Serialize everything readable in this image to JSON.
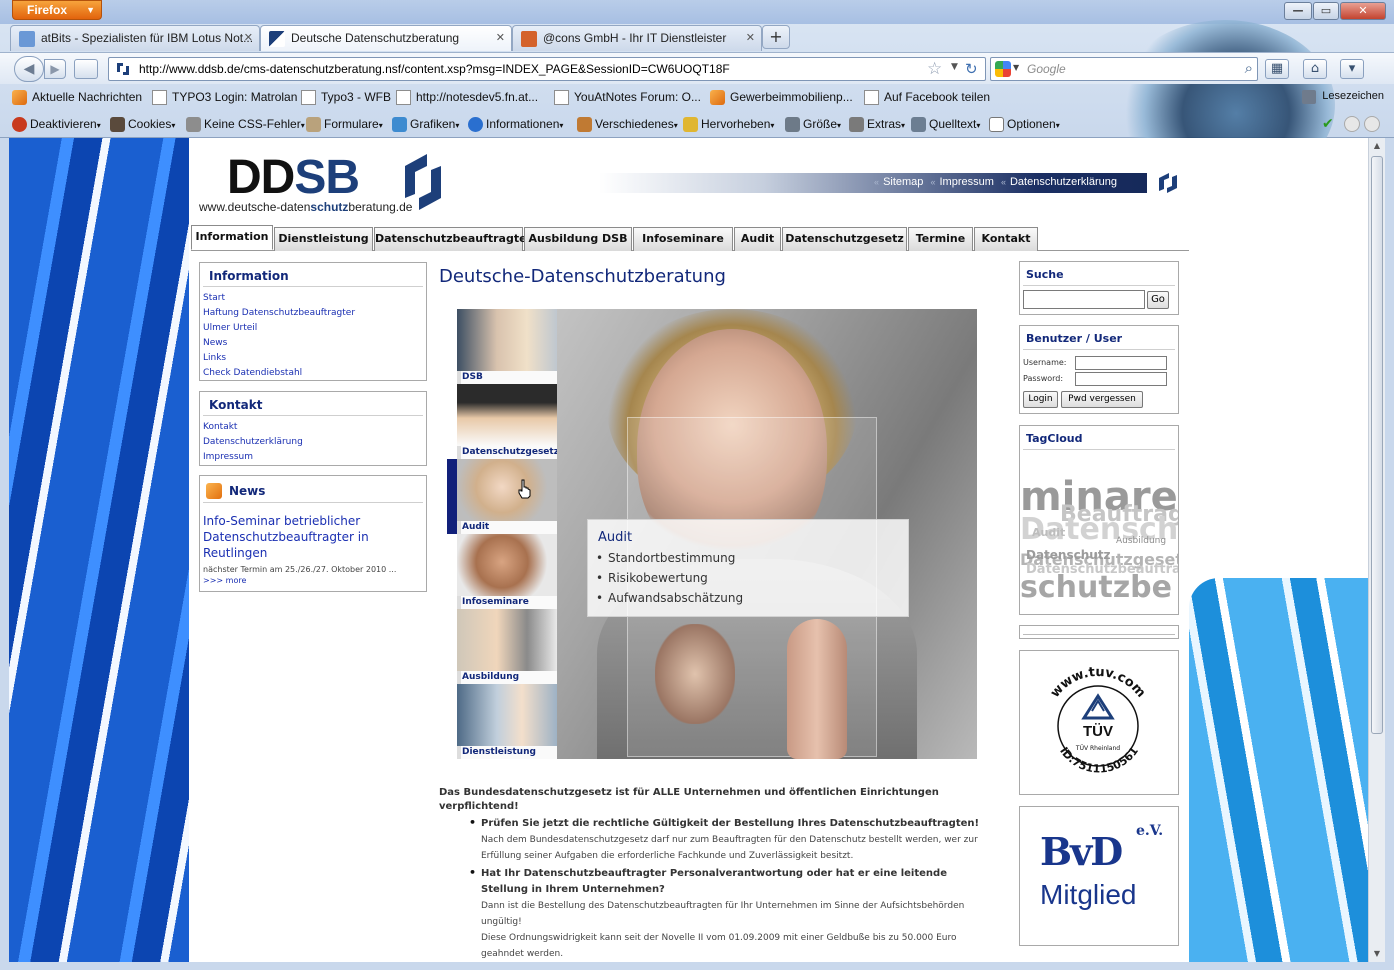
{
  "browser": {
    "app_button": "Firefox",
    "tabs": [
      {
        "title": "atBits - Spezialisten für IBM Lotus Not...",
        "active": false
      },
      {
        "title": "Deutsche Datenschutzberatung",
        "active": true
      },
      {
        "title": "@cons GmbH - Ihr IT Dienstleister",
        "active": false
      }
    ],
    "new_tab": "+",
    "url": "http://www.ddsb.de/cms-datenschutzberatung.nsf/content.xsp?msg=INDEX_PAGE&SessionID=CW6UOQT18F",
    "search_placeholder": "Google",
    "bookmarks": [
      "Aktuelle Nachrichten",
      "TYPO3 Login: Matrolan",
      "Typo3 - WFB",
      "http://notesdev5.fn.at...",
      "YouAtNotes Forum: O...",
      "Gewerbeimmobilienp...",
      "Auf Facebook teilen"
    ],
    "bookmarks_menu": "Lesezeichen",
    "devtools": [
      "Deaktivieren",
      "Cookies",
      "Keine CSS-Fehler",
      "Formulare",
      "Grafiken",
      "Informationen",
      "Verschiedenes",
      "Hervorheben",
      "Größe",
      "Extras",
      "Quelltext",
      "Optionen"
    ]
  },
  "site": {
    "logo_text_a": "DD",
    "logo_text_b": "SB",
    "logo_url_a": "www.deutsche-daten",
    "logo_url_b": "schutz",
    "logo_url_c": "beratung.de",
    "top_links": [
      "Sitemap",
      "Impressum",
      "Datenschutzerklärung"
    ],
    "top_sep": "«",
    "main_nav": [
      "Information",
      "Dienstleistung",
      "Datenschutzbeauftragte",
      "Ausbildung DSB",
      "Infoseminare",
      "Audit",
      "Datenschutzgesetz",
      "Termine",
      "Kontakt"
    ]
  },
  "left": {
    "information": {
      "title": "Information",
      "links": [
        "Start",
        "Haftung Datenschutzbeauftragter",
        "Ulmer Urteil",
        "News",
        "Links",
        "Check Datendiebstahl"
      ]
    },
    "kontakt": {
      "title": "Kontakt",
      "links": [
        "Kontakt",
        "Datenschutzerklärung",
        "Impressum"
      ]
    },
    "news": {
      "title": "News",
      "headline": "Info-Seminar betrieblicher Datenschutzbeauftragter in Reutlingen",
      "date": "nächster Termin am  25./26./27. Oktober 2010 ...",
      "more": ">>> more"
    }
  },
  "main": {
    "title": "Deutsche-Datenschutzberatung",
    "hero_thumbs": [
      "DSB",
      "Datenschutzgesetz",
      "Audit",
      "Infoseminare",
      "Ausbildung",
      "Dienstleistung"
    ],
    "callout": {
      "title": "Audit",
      "items": [
        "Standortbestimmung",
        "Risikobewertung",
        "Aufwandsabschätzung"
      ]
    },
    "intro": "Das Bundesdatenschutzgesetz ist für ALLE Unternehmen und öffentlichen Einrichtungen verpflichtend!",
    "list": [
      {
        "head": "Prüfen Sie jetzt die rechtliche Gültigkeit der Bestellung Ihres Datenschutzbeauftragten!",
        "body": "Nach dem Bundesdatenschutzgesetz darf nur zum Beauftragten für den Datenschutz bestellt werden, wer zur Erfüllung seiner Aufgaben die erforderliche Fachkunde und Zuverlässigkeit besitzt."
      },
      {
        "head": "Hat Ihr Datenschutzbeauftragter Personalverantwortung oder hat er eine leitende Stellung in Ihrem Unternehmen?",
        "body": "Dann ist die Bestellung des Datenschutzbeauftragten für Ihr Unternehmen im Sinne der Aufsichtsbehörden ungültig!",
        "body2": "Diese Ordnungswidrigkeit kann seit der Novelle II vom 01.09.2009 mit einer Geldbuße bis zu 50.000 Euro geahndet werden."
      }
    ]
  },
  "right": {
    "suche": {
      "title": "Suche",
      "go": "Go"
    },
    "user": {
      "title": "Benutzer / User",
      "username": "Username:",
      "password": "Password:",
      "login": "Login",
      "forgot": "Pwd vergessen"
    },
    "tagcloud": {
      "title": "TagCloud",
      "tags": [
        "minare",
        "Beauftragter",
        "Datenschutz",
        "Audit",
        "Ausbildung",
        "Datenschutzgesetz",
        "Datenschutz",
        "Datenschutzbeauftragte",
        "schutzbe"
      ]
    },
    "tuv": {
      "top": "www.tuv.com",
      "brand": "TÜV",
      "sub": "TÜV Rheinland",
      "id": "ID:7511150561"
    },
    "bvd": {
      "logo": "BvD",
      "ev": "e.V.",
      "sub": "Mitglied"
    }
  },
  "colors": {
    "brand_navy": "#12287a",
    "link_blue": "#1a2fb2",
    "active_thumb_bar": "#11207a"
  }
}
